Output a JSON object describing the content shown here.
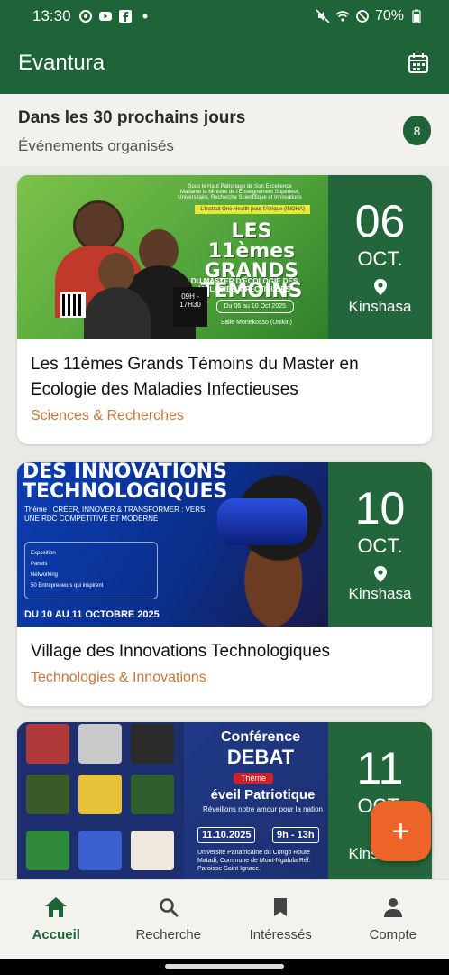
{
  "status_bar": {
    "time": "13:30",
    "battery": "70%",
    "icons": [
      "aperture-icon",
      "youtube-icon",
      "facebook-icon",
      "dot-icon",
      "mute-icon",
      "wifi-icon",
      "dnd-icon",
      "battery-icon"
    ]
  },
  "app_bar": {
    "title": "Evantura",
    "action_icon": "calendar-icon"
  },
  "summary": {
    "title": "Dans les 30 prochains jours",
    "subtitle": "Événements organisés",
    "count": "8"
  },
  "events": [
    {
      "day": "06",
      "month": "OCT.",
      "city": "Kinshasa",
      "title": "Les 11èmes Grands Témoins du Master en Ecologie des Maladies Infectieuses",
      "category": "Sciences & Recherches",
      "poster": {
        "header": "Sous le Haut Patronage de Son Excellence Madame la Ministre de l'Enseignement Supérieur, Universitaire, Recherche Scientifique et Innovations",
        "org": "L'Institut One Health pour l'Afrique (INOHA)",
        "title": "LES 11èmes GRANDS TÉMOINS",
        "subtitle": "DU MASTER D'ÉCOLOGIE DES MALADIES INFECTIEUSES",
        "dates": "Du 06 au 10 Oct 2025",
        "time": "09H - 17H30",
        "venue": "Salle Monekosso (Unikin)"
      }
    },
    {
      "day": "10",
      "month": "OCT.",
      "city": "Kinshasa",
      "title": "Village des Innovations Technologiques",
      "category": "Technologies & Innovations",
      "poster": {
        "title": "DES INNOVATIONS TECHNOLOGIQUES",
        "theme": "Thème : CRÉER, INNOVER & TRANSFORMER : VERS UNE RDC COMPÉTITIVE ET MODERNE",
        "activities": [
          "Exposition",
          "Panels",
          "Networking",
          "50 Entrepreneurs qui inspirent"
        ],
        "dates": "DU 10 AU 11 OCTOBRE 2025"
      }
    },
    {
      "day": "11",
      "month": "OCT.",
      "city": "Kinshasa",
      "title": "",
      "category": "",
      "poster": {
        "title1": "Conférence",
        "title2": "DEBAT",
        "theme": "Thème",
        "subject": "éveil Patriotique",
        "tagline": "Réveillons notre amour pour la nation",
        "date": "11.10.2025",
        "hours": "9h - 13h",
        "venue": "Université Panafricaine du Congo Route Matadi, Commune de Mont-Ngafula Réf: Paroisse Saint Ignace."
      }
    }
  ],
  "fab": {
    "icon": "plus-icon",
    "label": "+"
  },
  "bottom_nav": [
    {
      "label": "Accueil",
      "icon": "home-icon",
      "active": true
    },
    {
      "label": "Recherche",
      "icon": "search-icon",
      "active": false
    },
    {
      "label": "Intéressés",
      "icon": "bookmark-icon",
      "active": false
    },
    {
      "label": "Compte",
      "icon": "person-icon",
      "active": false
    }
  ],
  "colors": {
    "primary": "#1f6339",
    "accent": "#ec6428",
    "category": "#c8763a",
    "date_panel": "#23663c"
  }
}
